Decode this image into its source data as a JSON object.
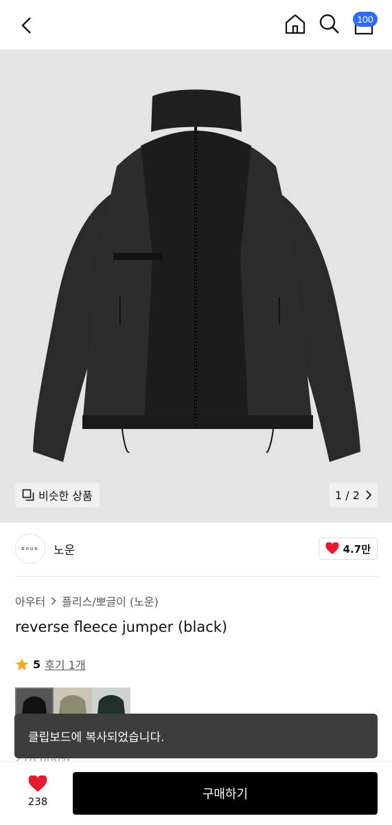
{
  "header": {
    "back_icon": "chevron-left-icon",
    "home_icon": "home-icon",
    "search_icon": "search-icon",
    "cart_icon": "shopping-bag-icon",
    "cart_badge": "100"
  },
  "gallery": {
    "similar_label": "비슷한 상품",
    "pager": "1 / 2"
  },
  "brand": {
    "logo_text": "noun",
    "name": "노운",
    "like_count": "4.7만"
  },
  "product": {
    "breadcrumb": [
      "아우터",
      "플리스/뽀글이 (노운)"
    ],
    "title": "reverse fleece jumper (black)",
    "rating": "5",
    "reviews": "후기 1개",
    "price_partial": "218,000원"
  },
  "toast": {
    "message": "클립보드에 복사되었습니다."
  },
  "bottom": {
    "wish_count": "238",
    "buy_label": "구매하기"
  },
  "colors": {
    "accent": "#2f6bff",
    "heart": "#e8192c",
    "star": "#f5a623",
    "buy_button": "#000000",
    "toast_bg": "#3d3d3d"
  }
}
